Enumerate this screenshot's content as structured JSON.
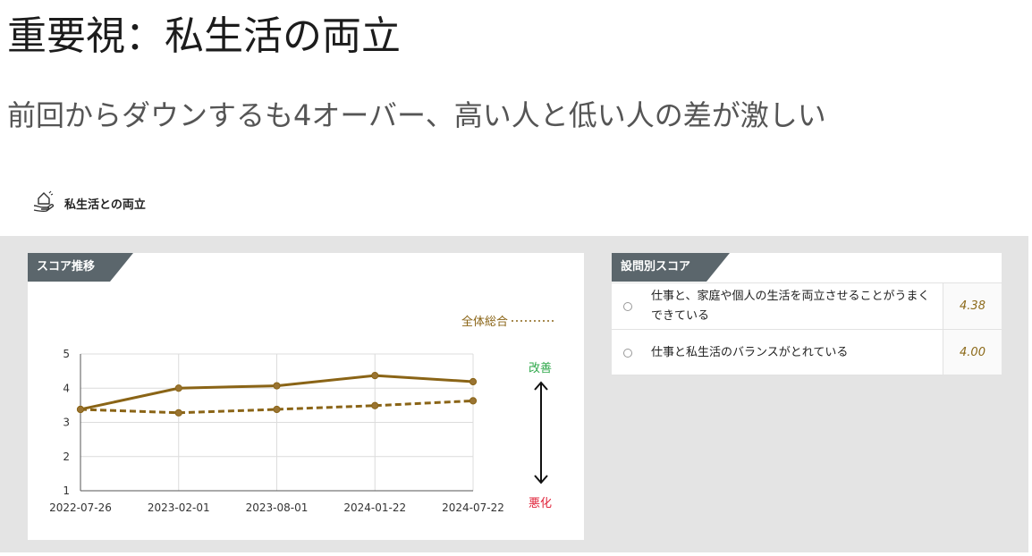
{
  "header": {
    "title": "重要視：私生活の両立",
    "subtitle": "前回からダウンするも4オーバー、高い人と低い人の差が激しい"
  },
  "section": {
    "label": "私生活との両立",
    "icon": "hand-home-icon"
  },
  "chart_panel": {
    "tab_label": "スコア推移"
  },
  "chart_data": {
    "type": "line",
    "categories": [
      "2022-07-26",
      "2023-02-01",
      "2023-08-01",
      "2024-01-22",
      "2024-07-22"
    ],
    "series": [
      {
        "name": "",
        "style": "solid",
        "color": "#8a6416",
        "values": [
          3.38,
          4.0,
          4.07,
          4.37,
          4.19
        ]
      },
      {
        "name": "全体総合",
        "style": "dashed",
        "color": "#8a6416",
        "values": [
          3.38,
          3.28,
          3.38,
          3.49,
          3.63
        ]
      }
    ],
    "yticks": [
      1,
      2,
      3,
      4,
      5
    ],
    "ylim": [
      1,
      5
    ],
    "legend": {
      "label": "全体総合",
      "placement": "top-right"
    },
    "side_labels": {
      "top": "改善",
      "bottom": "悪化",
      "top_color": "#2ea84a",
      "bottom_color": "#e0243b"
    },
    "grid": true
  },
  "questions_panel": {
    "tab_label": "設問別スコア",
    "rows": [
      {
        "text": "仕事と、家庭や個人の生活を両立させることがうまくできている",
        "score": "4.38"
      },
      {
        "text": "仕事と私生活のバランスがとれている",
        "score": "4.00"
      }
    ]
  }
}
